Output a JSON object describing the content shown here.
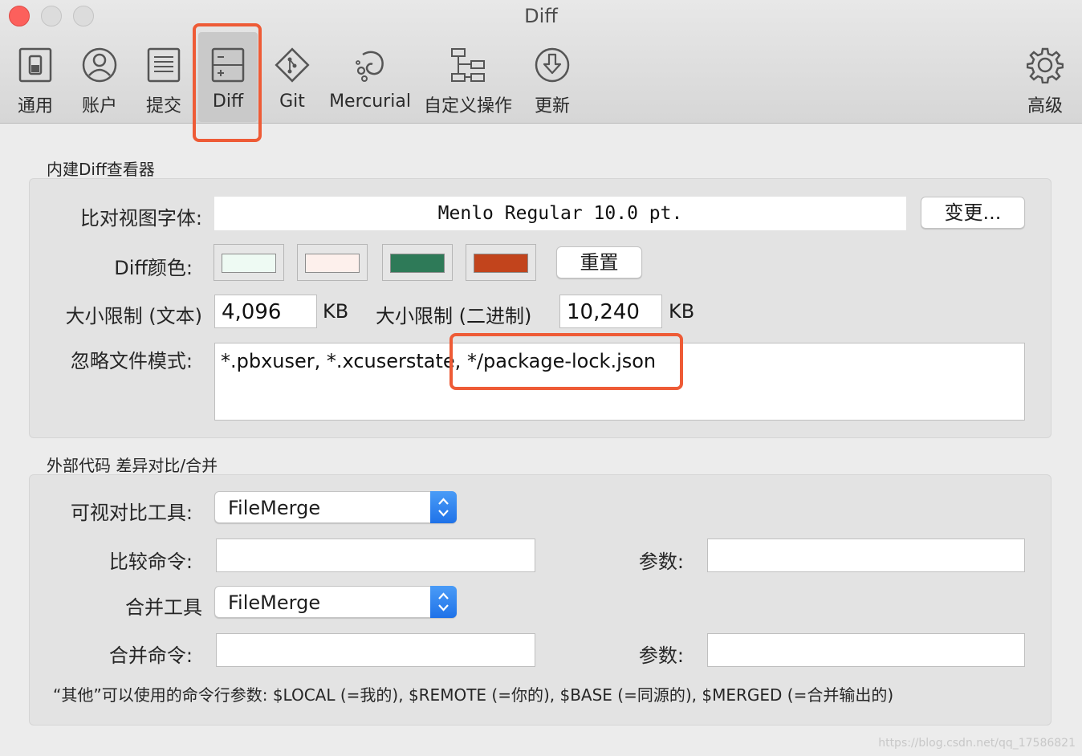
{
  "window": {
    "title": "Diff"
  },
  "toolbar": {
    "items": [
      {
        "label": "通用",
        "icon": "switch-icon"
      },
      {
        "label": "账户",
        "icon": "person-icon"
      },
      {
        "label": "提交",
        "icon": "document-icon"
      },
      {
        "label": "Diff",
        "icon": "diff-icon",
        "selected": true
      },
      {
        "label": "Git",
        "icon": "git-icon"
      },
      {
        "label": "Mercurial",
        "icon": "mercurial-icon"
      },
      {
        "label": "自定义操作",
        "icon": "custom-actions-icon"
      },
      {
        "label": "更新",
        "icon": "download-icon"
      },
      {
        "label": "高级",
        "icon": "gear-icon"
      }
    ]
  },
  "builtin": {
    "section_title": "内建Diff查看器",
    "font_label": "比对视图字体:",
    "font_value": "Menlo Regular 10.0 pt.",
    "change_button": "变更...",
    "color_label": "Diff颜色:",
    "colors": [
      "#eefaf3",
      "#fdf0ec",
      "#2e7a58",
      "#c2441c"
    ],
    "reset_button": "重置",
    "size_text_label": "大小限制 (文本)",
    "size_text_value": "4,096",
    "size_text_unit": "KB",
    "size_bin_label": "大小限制 (二进制)",
    "size_bin_value": "10,240",
    "size_bin_unit": "KB",
    "ignore_label": "忽略文件模式:",
    "ignore_value_start": "*.pbxuser, *.xcuserstate,",
    "ignore_value_end": "*/package-lock.json"
  },
  "external": {
    "section_title": "外部代码 差异对比/合并",
    "visual_tool_label": "可视对比工具:",
    "visual_tool_value": "FileMerge",
    "compare_cmd_label": "比较命令:",
    "compare_args_label": "参数:",
    "merge_tool_label": "合并工具",
    "merge_tool_value": "FileMerge",
    "merge_cmd_label": "合并命令:",
    "merge_args_label": "参数:",
    "footnote": "“其他”可以使用的命令行参数: $LOCAL (=我的), $REMOTE (=你的), $BASE (=同源的), $MERGED (=合并输出的)"
  },
  "watermark": "https://blog.csdn.net/qq_17586821"
}
